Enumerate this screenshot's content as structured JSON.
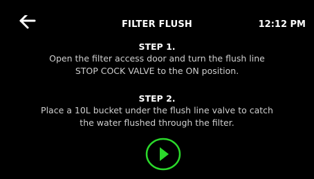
{
  "header": {
    "title": "FILTER FLUSH",
    "time": "12:12 PM",
    "back_icon": "arrow-left-icon"
  },
  "steps": [
    {
      "heading": "STEP 1.",
      "lines": [
        "Open the filter access door and turn the flush line",
        "STOP COCK VALVE to the ON position."
      ]
    },
    {
      "heading": "STEP 2.",
      "lines": [
        "Place a 10L bucket under the flush line valve to catch",
        "the water flushed through the filter."
      ]
    }
  ],
  "play_button": {
    "icon": "play-icon",
    "color": "#2bd92b"
  },
  "colors": {
    "background": "#000000",
    "text": "#ffffff",
    "body_text": "#cfcfcf",
    "accent": "#2bd92b"
  }
}
